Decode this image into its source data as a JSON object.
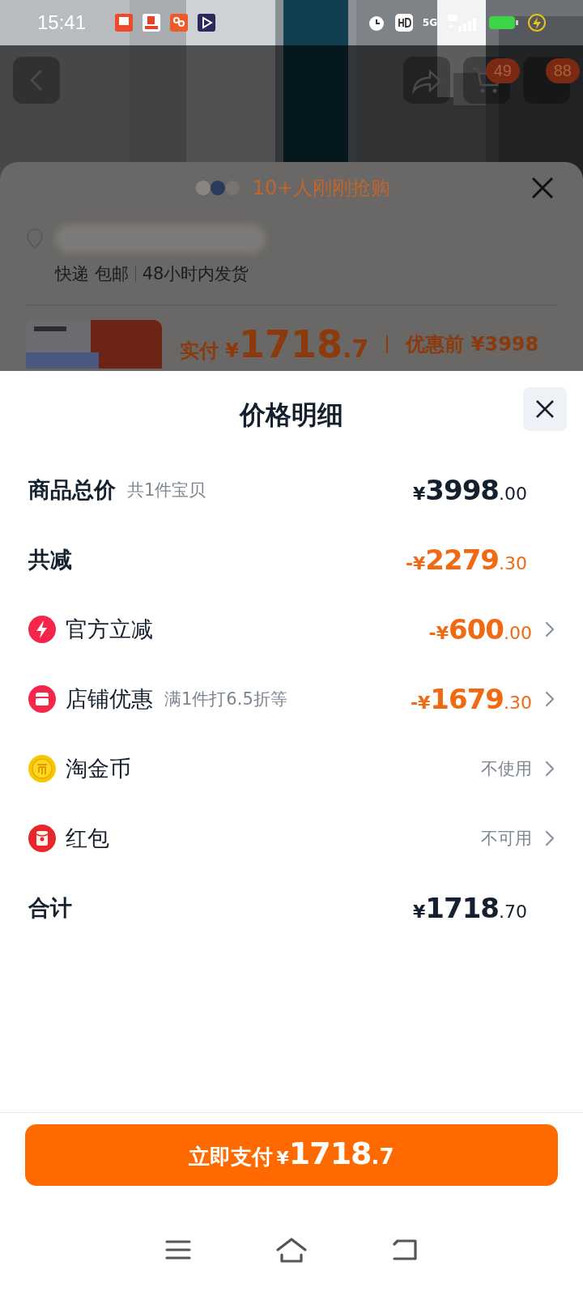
{
  "status_bar": {
    "time": "15:41",
    "network": "5G"
  },
  "header": {
    "badges": [
      "49",
      "88"
    ]
  },
  "order_panel": {
    "buyers_text": "10+人刚刚抢购",
    "shipping": [
      "快递 包邮",
      "48小时内发货"
    ],
    "price": {
      "label": "实付",
      "currency": "¥",
      "integer": "1718",
      "fraction": ".7",
      "original_label": "优惠前",
      "original": "¥3998"
    }
  },
  "sheet": {
    "title": "价格明细",
    "rows": [
      {
        "kind": "summary",
        "label": "商品总价",
        "note": "共1件宝贝",
        "color": "#15202e",
        "prefix": "¥",
        "main": "3998",
        "fraction": ".00"
      },
      {
        "kind": "summary",
        "label": "共减",
        "color": "#f06a14",
        "prefix": "-¥",
        "main": "2279",
        "fraction": ".30"
      },
      {
        "kind": "instant",
        "label": "官方立减",
        "color": "#f06a14",
        "prefix": "-¥",
        "main": "600",
        "fraction": ".00"
      },
      {
        "kind": "store",
        "label": "店铺优惠",
        "note": "满1件打6.5折等",
        "color": "#f06a14",
        "prefix": "-¥",
        "main": "1679",
        "fraction": ".30"
      },
      {
        "kind": "coins",
        "label": "淘金币",
        "status": "不使用"
      },
      {
        "kind": "packet",
        "label": "红包",
        "status": "不可用"
      },
      {
        "kind": "summary",
        "label": "合计",
        "color": "#15202e",
        "prefix": "¥",
        "main": "1718",
        "fraction": ".70"
      }
    ]
  },
  "pay_button": {
    "label": "立即支付",
    "currency": "¥",
    "integer": "1718",
    "fraction": ".7"
  }
}
